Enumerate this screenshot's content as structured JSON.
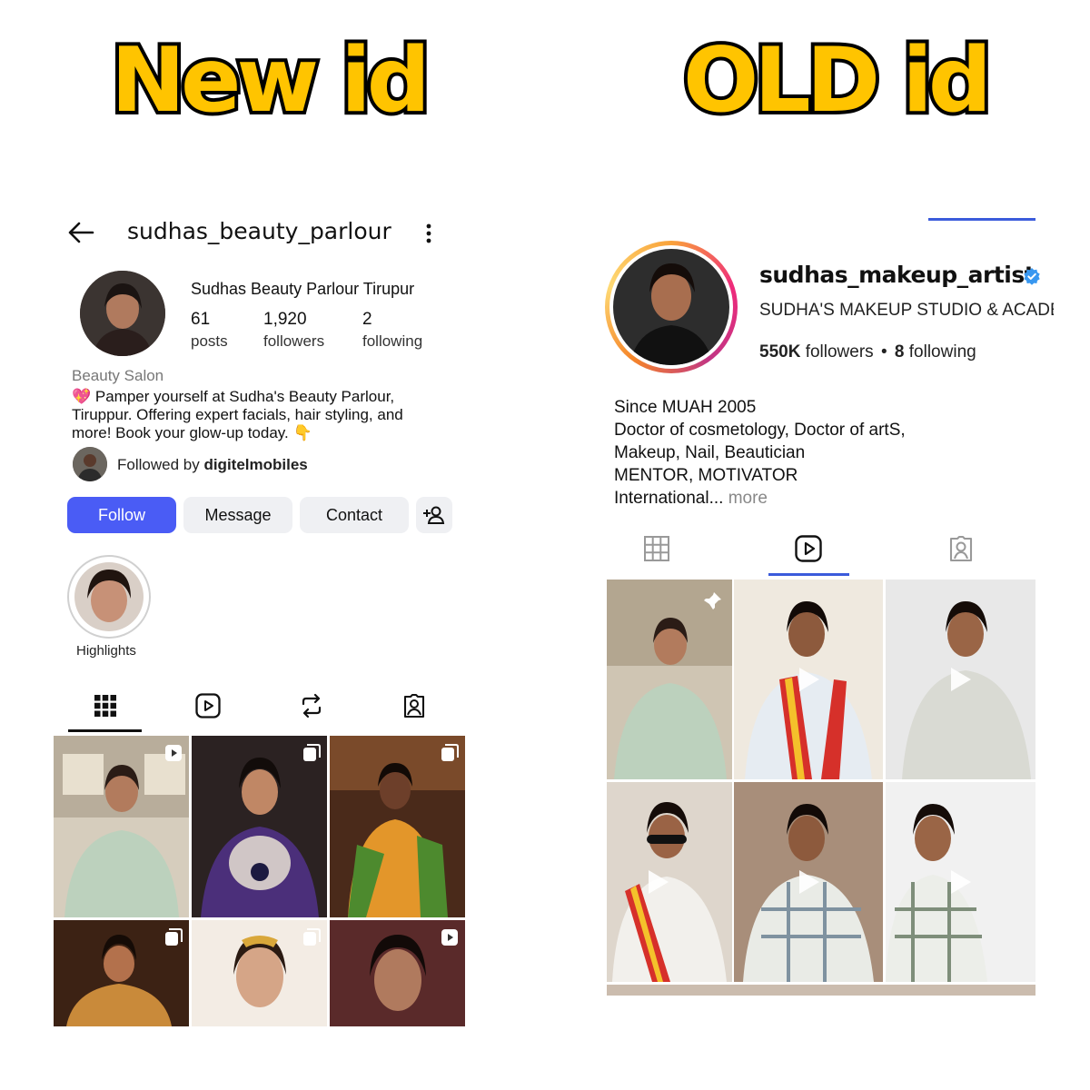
{
  "labels": {
    "new": "New id",
    "old": "OLD id"
  },
  "new_profile": {
    "username": "sudhas_beauty_parlour",
    "display_name": "Sudhas Beauty Parlour Tirupur",
    "stats": [
      {
        "value": "61",
        "label": "posts"
      },
      {
        "value": "1,920",
        "label": "followers"
      },
      {
        "value": "2",
        "label": "following"
      }
    ],
    "category": "Beauty Salon",
    "bio_lines": [
      "💖 Pamper yourself at Sudha's Beauty Parlour,",
      "Tiruppur. Offering expert facials, hair styling, and",
      "more! Book your glow-up today. 👇"
    ],
    "followed_by_prefix": "Followed by",
    "followed_by_user": "digitelmobiles",
    "buttons": {
      "follow": "Follow",
      "message": "Message",
      "contact": "Contact"
    },
    "highlight_label": "Highlights",
    "icons": [
      "back-arrow-icon",
      "more-vertical-icon",
      "add-person-icon",
      "grid-icon",
      "reels-icon",
      "repost-icon",
      "tagged-icon"
    ],
    "accent": "#4a5cf5"
  },
  "old_profile": {
    "username": "sudhas_makeup_artist",
    "verified": true,
    "display_name": "SUDHA'S MAKEUP STUDIO & ACADEM",
    "followers_value": "550K",
    "followers_label": "followers",
    "following_value": "8",
    "following_label": "following",
    "bio_lines": [
      "Since MUAH 2005",
      "Doctor of cosmetology, Doctor of artS,",
      "Makeup, Nail, Beautician",
      "MENTOR, MOTIVATOR"
    ],
    "bio_last": "International...",
    "more_label": "more",
    "icons": [
      "grid-icon",
      "reels-icon",
      "tagged-icon",
      "pin-icon",
      "play-icon",
      "verified-icon"
    ],
    "verified_color": "#3897f0"
  }
}
